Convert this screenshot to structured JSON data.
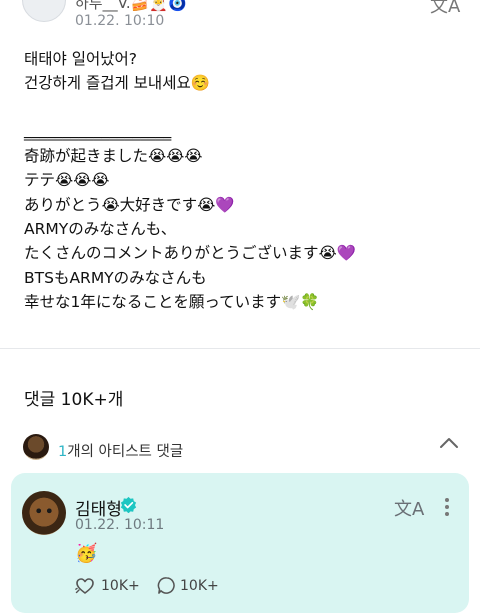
{
  "post": {
    "username": "하루__V.🍰🎅🧿",
    "date": "01.22. 10:10",
    "translate_glyph": "文A",
    "lines": [
      "태태야 일어났어?",
      "건강하게 즐겁게 보내세요☺️",
      "",
      "‗‗‗‗‗‗‗‗‗‗‗‗‗‗‗‗‗‗‗",
      "奇跡が起きました😭😭😭",
      "テテ😭😭😭",
      "ありがとう😭大好きです😭💜",
      "ARMYのみなさんも、",
      "たくさんのコメントありがとうございます😭💜",
      "BTSもARMYのみなさんも",
      "幸せな1年になることを願っています🕊️🍀"
    ]
  },
  "comments": {
    "count_label": "댓글 10K+개"
  },
  "artist_section": {
    "count": "1",
    "label": "개의 아티스트 댓글"
  },
  "artist_comment": {
    "name": "김태형",
    "date": "01.22. 10:11",
    "body": "🥳",
    "likes": "10K+",
    "replies": "10K+",
    "translate_glyph": "文A"
  },
  "colors": {
    "card_bg": "#d9f5f2",
    "accent": "#2eb5c6",
    "verified": "#1ec6c2"
  }
}
